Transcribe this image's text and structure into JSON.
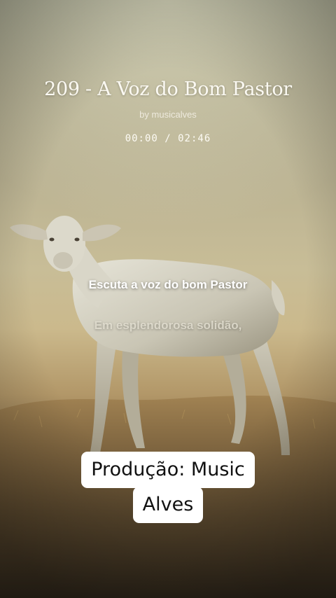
{
  "player": {
    "title": "209 - A Voz do Bom Pastor",
    "artist": "by musicalves",
    "time": "00:00 / 02:46"
  },
  "lyrics": {
    "current": "Escuta a voz do bom Pastor",
    "next": "Em esplendorosa solidão,"
  },
  "caption": {
    "line1": "Produção: Music",
    "line2": "Alves"
  },
  "background": {
    "icon": "lamb-illustration",
    "sky_color": "#bbb393",
    "ground_color": "#4a3b28"
  }
}
